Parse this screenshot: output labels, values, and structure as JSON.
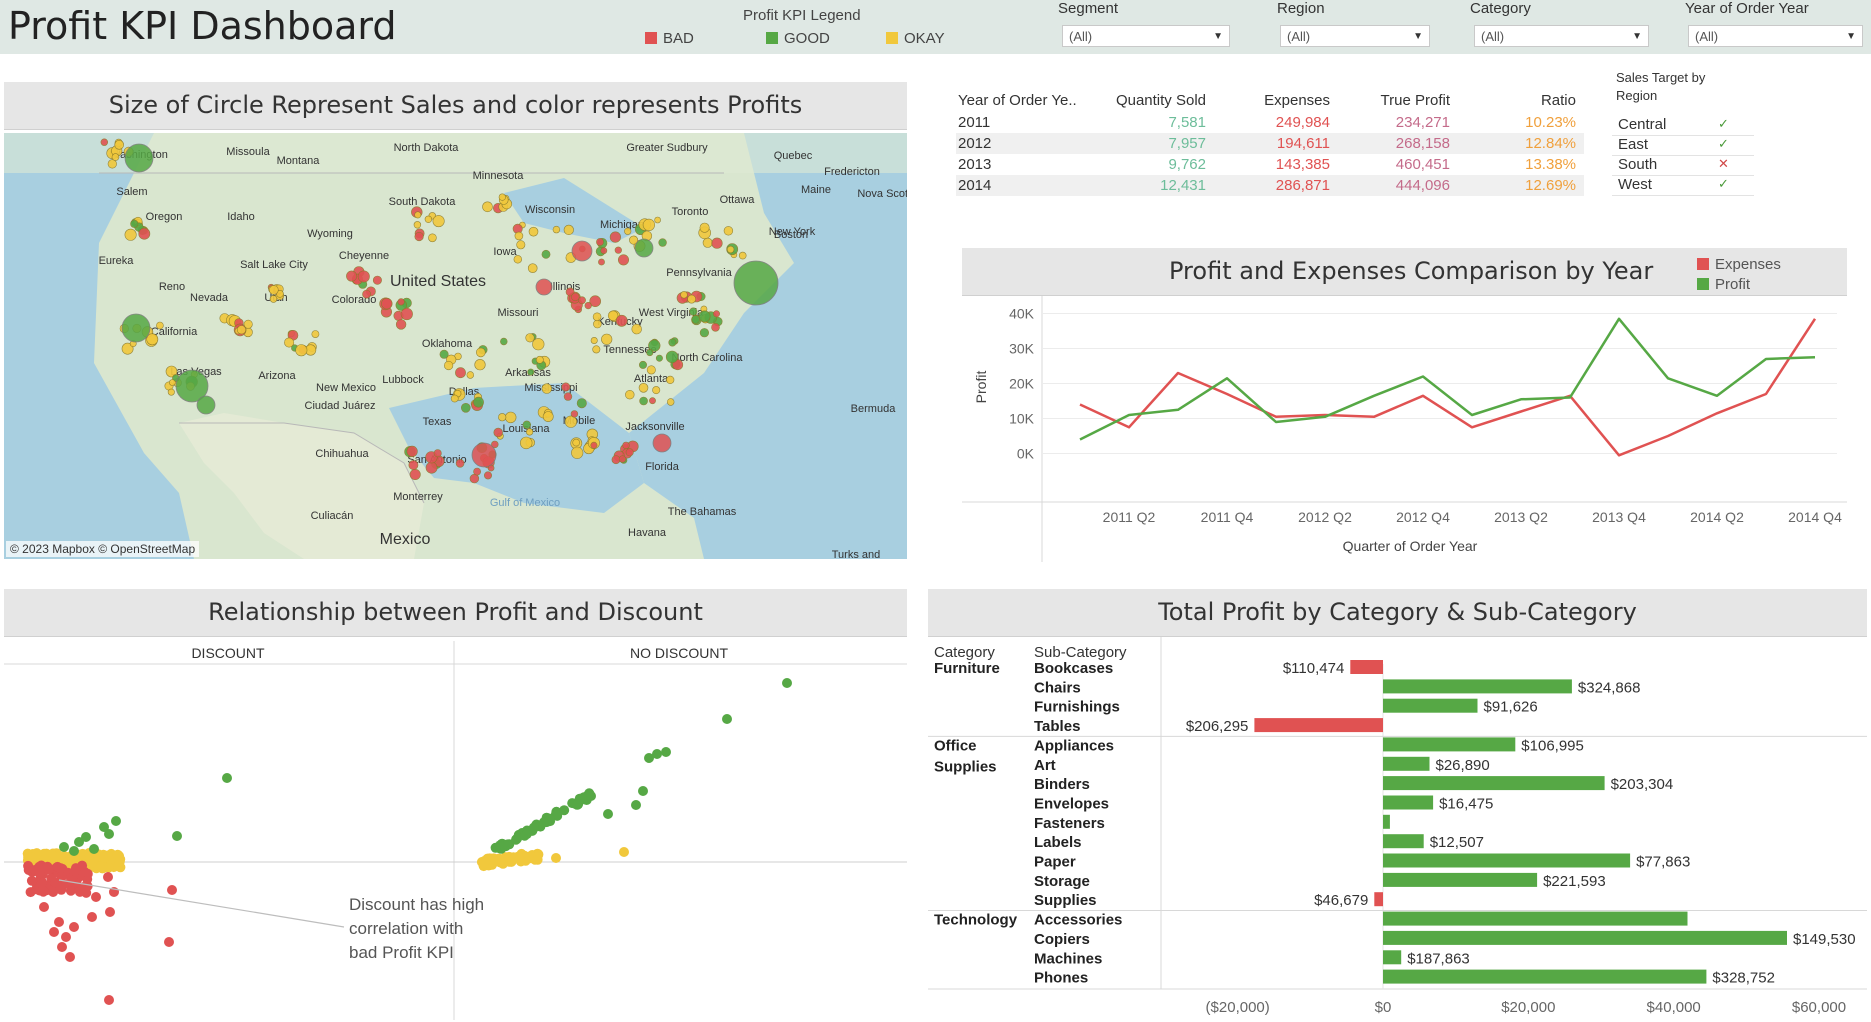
{
  "header": {
    "title": "Profit KPI Dashboard",
    "legend_title": "Profit KPI Legend",
    "legend": [
      {
        "label": "BAD",
        "color": "#e05252"
      },
      {
        "label": "GOOD",
        "color": "#56a845"
      },
      {
        "label": "OKAY",
        "color": "#f1c83c"
      }
    ],
    "filters": [
      {
        "label": "Segment",
        "value": "(All)"
      },
      {
        "label": "Region",
        "value": "(All)"
      },
      {
        "label": "Category",
        "value": "(All)"
      },
      {
        "label": "Year of Order Year",
        "value": "(All)"
      }
    ]
  },
  "map_panel": {
    "title": "Size of Circle Represent Sales and color represents Profits",
    "credit": "© 2023 Mapbox © OpenStreetMap",
    "places": [
      "Washington",
      "Missoula",
      "Montana",
      "North Dakota",
      "Greater Sudbury",
      "Quebec",
      "Fredericton",
      "Maine",
      "Nova Scotia",
      "Salem",
      "Oregon",
      "Idaho",
      "Minnesota",
      "South Dakota",
      "Ottawa",
      "Wyoming",
      "Wisconsin",
      "Toronto",
      "Eureka",
      "Salt Lake City",
      "Cheyenne",
      "Michigan",
      "New York",
      "Boston",
      "Iowa",
      "United States",
      "Reno",
      "Nevada",
      "Utah",
      "Colorado",
      "Illinois",
      "Pennsylvania",
      "California",
      "Missouri",
      "West Virginia",
      "Kentucky",
      "Oklahoma",
      "Tennessee",
      "North Carolina",
      "Las Vegas",
      "Arizona",
      "New Mexico",
      "Lubbock",
      "Arkansas",
      "Atlanta",
      "Ciudad Juárez",
      "Mississippi",
      "Dallas",
      "Texas",
      "Louisiana",
      "Mobile",
      "Jacksonville",
      "Chihuahua",
      "San Antonio",
      "Bermuda",
      "Florida",
      "Monterrey",
      "The Bahamas",
      "Culiacán",
      "Gulf of Mexico",
      "Havana",
      "Mexico",
      "Turks and"
    ]
  },
  "kpi_table": {
    "columns": [
      "Year of Order Ye..",
      "Quantity Sold",
      "Expenses",
      "True Profit",
      "Ratio"
    ],
    "rows": [
      {
        "year": "2011",
        "qty": "7,581",
        "expenses": "249,984",
        "profit": "234,271",
        "ratio": "10.23%"
      },
      {
        "year": "2012",
        "qty": "7,957",
        "expenses": "194,611",
        "profit": "268,158",
        "ratio": "12.84%"
      },
      {
        "year": "2013",
        "qty": "9,762",
        "expenses": "143,385",
        "profit": "460,451",
        "ratio": "13.38%"
      },
      {
        "year": "2014",
        "qty": "12,431",
        "expenses": "286,871",
        "profit": "444,096",
        "ratio": "12.69%"
      }
    ],
    "colors": {
      "qty": "#6dbd9a",
      "expenses": "#e05252",
      "profit": "#c46b8a",
      "ratio": "#f0a03c"
    }
  },
  "sales_target": {
    "title_line1": "Sales Target by",
    "title_line2": "Region",
    "rows": [
      {
        "region": "Central",
        "mark": "✓",
        "met": true
      },
      {
        "region": "East",
        "mark": "✓",
        "met": true
      },
      {
        "region": "South",
        "mark": "✕",
        "met": false
      },
      {
        "region": "West",
        "mark": "✓",
        "met": true
      }
    ]
  },
  "line_panel": {
    "title": "Profit and Expenses Comparison by Year"
  },
  "scatter_panel": {
    "title": "Relationship between Profit and Discount",
    "facets": [
      "DISCOUNT",
      "NO DISCOUNT"
    ],
    "annotation_lines": [
      "Discount has high",
      "correlation with",
      "bad Profit KPI"
    ]
  },
  "bar_panel": {
    "title": "Total Profit by Category & Sub-Category",
    "col_category": "Category",
    "col_subcategory": "Sub-Category"
  },
  "chart_data": [
    {
      "type": "line",
      "title": "Profit and Expenses Comparison by Year",
      "xlabel": "Quarter of Order Year",
      "ylabel": "Profit",
      "x": [
        "2011 Q1",
        "2011 Q2",
        "2011 Q3",
        "2011 Q4",
        "2012 Q1",
        "2012 Q2",
        "2012 Q3",
        "2012 Q4",
        "2013 Q1",
        "2013 Q2",
        "2013 Q3",
        "2013 Q4",
        "2014 Q1",
        "2014 Q2",
        "2014 Q3",
        "2014 Q4"
      ],
      "x_tick_labels": [
        "2011 Q2",
        "2011 Q4",
        "2012 Q2",
        "2012 Q4",
        "2013 Q2",
        "2013 Q4",
        "2014 Q2",
        "2014 Q4"
      ],
      "y_tick_labels": [
        "0K",
        "10K",
        "20K",
        "30K",
        "40K"
      ],
      "ylim": [
        -3000,
        41000
      ],
      "series": [
        {
          "name": "Expenses",
          "color": "#e05252",
          "values": [
            14000,
            7500,
            23000,
            17000,
            10500,
            11000,
            10500,
            16500,
            7500,
            12000,
            16500,
            -500,
            5000,
            11500,
            17000,
            38500
          ]
        },
        {
          "name": "Profit",
          "color": "#56a845",
          "values": [
            4000,
            11000,
            12500,
            21500,
            9000,
            10500,
            16500,
            22000,
            11000,
            15500,
            16000,
            38500,
            21500,
            16500,
            27000,
            27500
          ]
        }
      ],
      "legend_position": "top-right",
      "grid": true
    },
    {
      "type": "bar",
      "title": "Total Profit by Category & Sub-Category",
      "orientation": "horizontal",
      "x_tick_labels": [
        "($20,000)",
        "$0",
        "$20,000",
        "$40,000",
        "$60,000"
      ],
      "xlim": [
        -27000,
        66000
      ],
      "groups": [
        {
          "category_lines": [
            "Furniture"
          ],
          "items": [
            {
              "name": "Bookcases",
              "value": -4500,
              "label": "$110,474",
              "kpi": "BAD"
            },
            {
              "name": "Chairs",
              "value": 26000,
              "label": "$324,868",
              "kpi": "GOOD"
            },
            {
              "name": "Furnishings",
              "value": 13000,
              "label": "$91,626",
              "kpi": "GOOD"
            },
            {
              "name": "Tables",
              "value": -17700,
              "label": "$206,295",
              "kpi": "BAD"
            }
          ]
        },
        {
          "category_lines": [
            "Office",
            "Supplies"
          ],
          "items": [
            {
              "name": "Appliances",
              "value": 18200,
              "label": "$106,995",
              "kpi": "GOOD"
            },
            {
              "name": "Art",
              "value": 6400,
              "label": "$26,890",
              "kpi": "GOOD"
            },
            {
              "name": "Binders",
              "value": 30500,
              "label": "$203,304",
              "kpi": "GOOD"
            },
            {
              "name": "Envelopes",
              "value": 6900,
              "label": "$16,475",
              "kpi": "GOOD"
            },
            {
              "name": "Fasteners",
              "value": 950,
              "label": "",
              "kpi": "GOOD"
            },
            {
              "name": "Labels",
              "value": 5600,
              "label": "$12,507",
              "kpi": "GOOD"
            },
            {
              "name": "Paper",
              "value": 34000,
              "label": "$77,863",
              "kpi": "GOOD"
            },
            {
              "name": "Storage",
              "value": 21200,
              "label": "$221,593",
              "kpi": "GOOD"
            },
            {
              "name": "Supplies",
              "value": -1200,
              "label": "$46,679",
              "kpi": "BAD"
            }
          ]
        },
        {
          "category_lines": [
            "Technology"
          ],
          "items": [
            {
              "name": "Accessories",
              "value": 41900,
              "label": "",
              "kpi": "GOOD"
            },
            {
              "name": "Copiers",
              "value": 55600,
              "label": "$149,530",
              "kpi": "GOOD"
            },
            {
              "name": "Machines",
              "value": 2500,
              "label": "$187,863",
              "kpi": "GOOD"
            },
            {
              "name": "Phones",
              "value": 44500,
              "label": "$328,752",
              "kpi": "GOOD"
            }
          ]
        }
      ]
    }
  ]
}
